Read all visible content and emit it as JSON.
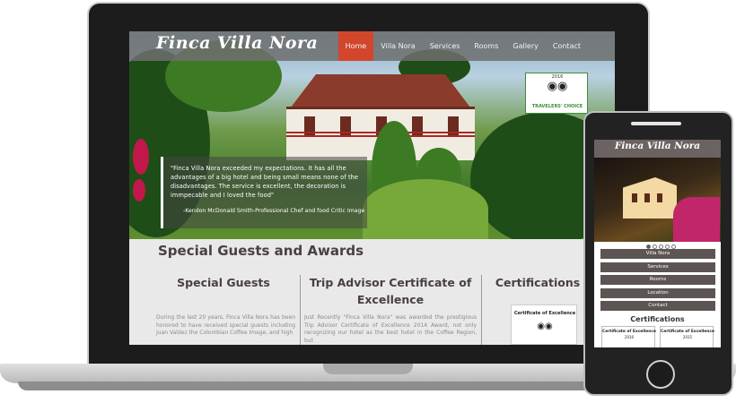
{
  "desktop": {
    "logo": "Finca Villa Nora",
    "nav": [
      "Home",
      "Villa Nora",
      "Services",
      "Rooms",
      "Gallery",
      "Contact"
    ],
    "active_nav": "Home",
    "badge": {
      "year": "2016",
      "text": "TRAVELERS' CHOICE"
    },
    "quote": {
      "text": "\"Finca Villa Nora exceeded my expectations. It has all the advantages of a big hotel and being small means none of the disadvantages. The service is excellent, the decoration is immpecable and I loved the food\"",
      "author": "-Kendon McDonald Smith-Professional Chef and food Critic Image"
    },
    "section_title": "Special Guests and Awards",
    "columns": [
      {
        "title": "Special Guests",
        "text": "During the last 20 years, Finca Villa Nora has been honored to have received special guests including Juan Valdez the Colombian Coffee Image, and high"
      },
      {
        "title": "Trip Advisor Certificate of Excellence",
        "text": "Just Recently \"Finca Villa Nora\" was awarded the prestigious Trip Advisor Certificate of Excellence 2014 Award, not only recognizing our hotel as the best hotel in the Coffee Region, but"
      },
      {
        "title": "Certifications",
        "text": ""
      }
    ],
    "cert_card_title": "Certificate of Excellence",
    "cert_card_year": "2016"
  },
  "mobile": {
    "logo": "Finca Villa Nora",
    "menu": [
      "Villa Nora",
      "Services",
      "Rooms",
      "Location",
      "Contact"
    ],
    "certifications_title": "Certifications",
    "cards": [
      {
        "title": "Certificate of Excellence",
        "year": "2016"
      },
      {
        "title": "Certificate of Excellence",
        "year": "2015"
      }
    ],
    "slider_dots": 5,
    "active_dot": 1
  }
}
